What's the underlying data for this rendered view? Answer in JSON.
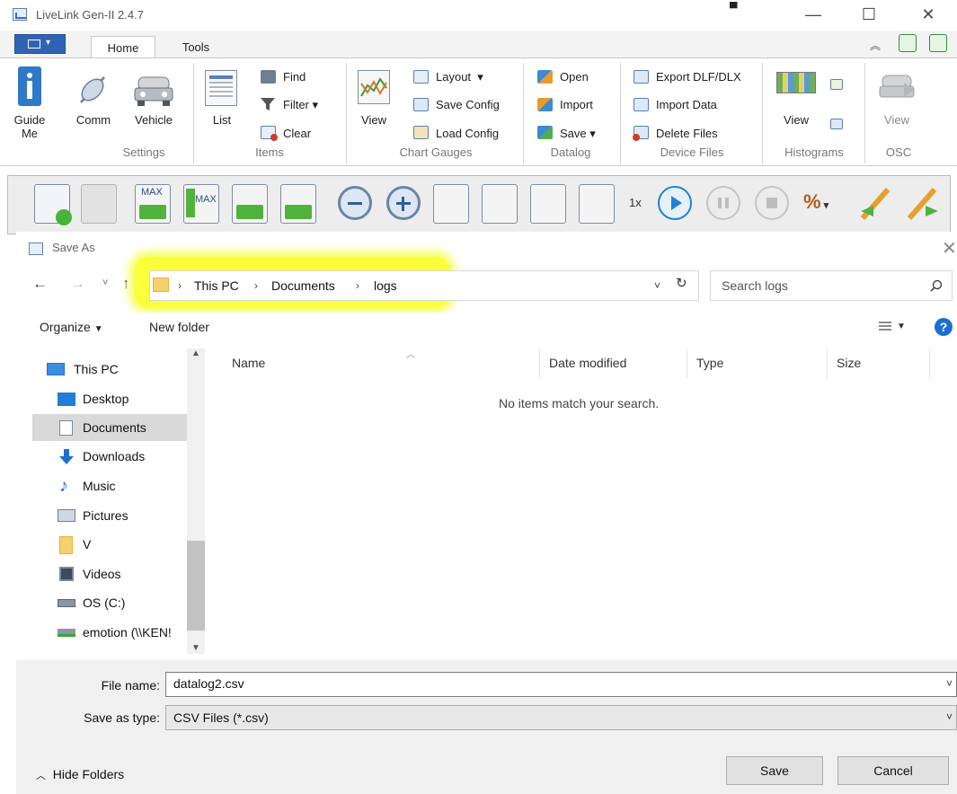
{
  "app": {
    "title": "LiveLink Gen-II 2.4.7",
    "window_controls": {
      "minimize": "—",
      "maximize": "☐",
      "close": "✕"
    }
  },
  "ribbon": {
    "tabs": [
      {
        "label": "Home",
        "active": true
      },
      {
        "label": "Tools",
        "active": false
      }
    ],
    "groups": {
      "settings": {
        "label": "Settings",
        "guide_label_1": "Guide",
        "guide_label_2": "Me",
        "comm_label": "Comm",
        "vehicle_label": "Vehicle"
      },
      "items": {
        "label": "Items",
        "list_label": "List",
        "find_label": "Find",
        "filter_label": "Filter",
        "clear_label": "Clear"
      },
      "chart_gauges": {
        "label": "Chart Gauges",
        "view_label": "View",
        "layout_label": "Layout",
        "save_config_label": "Save Config",
        "load_config_label": "Load Config"
      },
      "datalog": {
        "label": "Datalog",
        "open_label": "Open",
        "import_label": "Import",
        "save_label": "Save"
      },
      "device_files": {
        "label": "Device Files",
        "export_label": "Export DLF/DLX",
        "import_data_label": "Import Data",
        "delete_label": "Delete Files"
      },
      "histograms": {
        "label": "Histograms",
        "view_label": "View"
      },
      "osc": {
        "label": "OSC",
        "view_label": "View"
      }
    }
  },
  "toolbar": {
    "speed_label": "1x",
    "percent_label": "%"
  },
  "dialog": {
    "title": "Save As",
    "close": "✕",
    "address": {
      "segments": [
        "This PC",
        "Documents",
        "logs"
      ]
    },
    "search": {
      "placeholder": "Search logs"
    },
    "organize_label": "Organize",
    "new_folder_label": "New folder",
    "nav": {
      "items": [
        {
          "label": "This PC",
          "icon": "computer-icon"
        },
        {
          "label": "Desktop",
          "icon": "desktop-icon"
        },
        {
          "label": "Documents",
          "icon": "documents-icon",
          "selected": true
        },
        {
          "label": "Downloads",
          "icon": "downloads-icon"
        },
        {
          "label": "Music",
          "icon": "music-icon"
        },
        {
          "label": "Pictures",
          "icon": "pictures-icon"
        },
        {
          "label": "V",
          "icon": "folder-icon"
        },
        {
          "label": "Videos",
          "icon": "videos-icon"
        },
        {
          "label": "OS (C:)",
          "icon": "drive-icon"
        },
        {
          "label": "emotion (\\\\KEN!",
          "icon": "network-drive-icon"
        }
      ]
    },
    "columns": [
      "Name",
      "Date modified",
      "Type",
      "Size"
    ],
    "empty_message": "No items match your search.",
    "file_name_label": "File name:",
    "file_name_value": "datalog2.csv",
    "save_type_label": "Save as type:",
    "save_type_value": "CSV Files (*.csv)",
    "hide_folders_label": "Hide Folders",
    "save_button": "Save",
    "cancel_button": "Cancel"
  },
  "colors": {
    "accent_blue": "#2f64b5",
    "highlight_yellow": "#fbff3a",
    "play_blue": "#1e82d2",
    "help_blue": "#1a6fd0"
  }
}
